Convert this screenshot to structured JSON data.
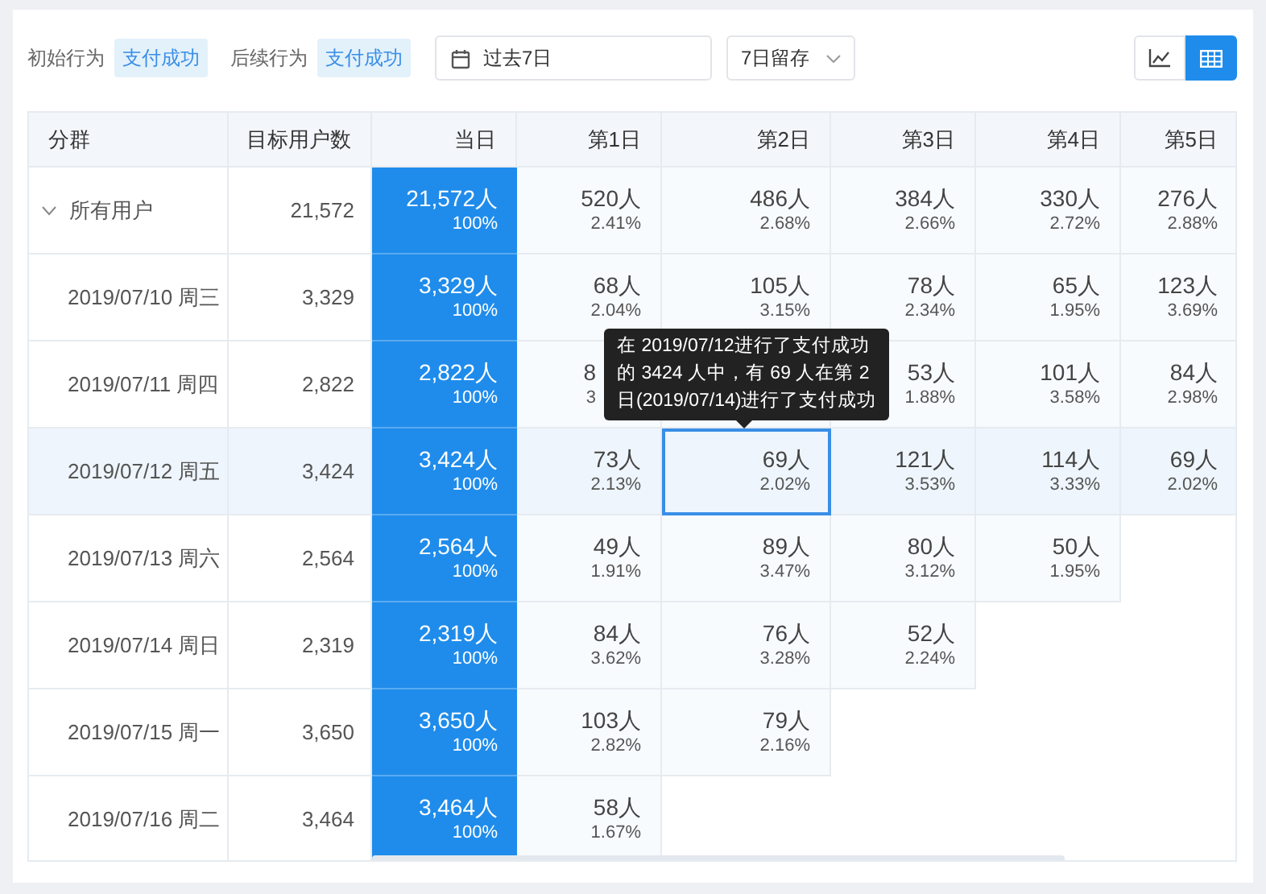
{
  "filters": [
    {
      "label": "初始行为",
      "tag": "支付成功"
    },
    {
      "label": "后续行为",
      "tag": "支付成功"
    }
  ],
  "date_range": {
    "value": "过去7日"
  },
  "retention_select": {
    "value": "7日留存"
  },
  "view_toggle": [
    {
      "kind": "line",
      "selected": false
    },
    {
      "kind": "table",
      "selected": true
    }
  ],
  "table": {
    "columns": [
      "分群",
      "目标用户数",
      "当日",
      "第1日",
      "第2日",
      "第3日",
      "第4日",
      "第5日"
    ],
    "rows": [
      {
        "kind": "group",
        "expanded": true,
        "selected": false,
        "label": "所有用户",
        "target": "21,572",
        "day0": {
          "count": "21,572人",
          "pct": "100%"
        },
        "days": [
          {
            "count": "520人",
            "pct": "2.41%",
            "selected": false
          },
          {
            "count": "486人",
            "pct": "2.68%",
            "selected": false
          },
          {
            "count": "384人",
            "pct": "2.66%",
            "selected": false
          },
          {
            "count": "330人",
            "pct": "2.72%",
            "selected": false
          },
          {
            "count": "276人",
            "pct": "2.88%",
            "selected": false
          }
        ]
      },
      {
        "kind": "date",
        "selected": false,
        "label": "2019/07/10 周三",
        "target": "3,329",
        "day0": {
          "count": "3,329人",
          "pct": "100%"
        },
        "days": [
          {
            "count": "68人",
            "pct": "2.04%",
            "selected": false
          },
          {
            "count": "105人",
            "pct": "3.15%",
            "selected": false
          },
          {
            "count": "78人",
            "pct": "2.34%",
            "selected": false
          },
          {
            "count": "65人",
            "pct": "1.95%",
            "selected": false
          },
          {
            "count": "123人",
            "pct": "3.69%",
            "selected": false
          }
        ]
      },
      {
        "kind": "date",
        "selected": false,
        "label": "2019/07/11 周四",
        "target": "2,822",
        "day0": {
          "count": "2,822人",
          "pct": "100%"
        },
        "days": [
          {
            "count": "8",
            "pct": "3",
            "selected": false,
            "clipped": true
          },
          {
            "hidden": true,
            "selected": false
          },
          {
            "count": "53人",
            "pct": "1.88%",
            "selected": false
          },
          {
            "count": "101人",
            "pct": "3.58%",
            "selected": false
          },
          {
            "count": "84人",
            "pct": "2.98%",
            "selected": false
          }
        ]
      },
      {
        "kind": "date",
        "selected": true,
        "label": "2019/07/12 周五",
        "target": "3,424",
        "day0": {
          "count": "3,424人",
          "pct": "100%"
        },
        "days": [
          {
            "count": "73人",
            "pct": "2.13%",
            "selected": false
          },
          {
            "count": "69人",
            "pct": "2.02%",
            "selected": true
          },
          {
            "count": "121人",
            "pct": "3.53%",
            "selected": false
          },
          {
            "count": "114人",
            "pct": "3.33%",
            "selected": false
          },
          {
            "count": "69人",
            "pct": "2.02%",
            "selected": false
          }
        ]
      },
      {
        "kind": "date",
        "selected": false,
        "label": "2019/07/13 周六",
        "target": "2,564",
        "day0": {
          "count": "2,564人",
          "pct": "100%"
        },
        "days": [
          {
            "count": "49人",
            "pct": "1.91%",
            "selected": false
          },
          {
            "count": "89人",
            "pct": "3.47%",
            "selected": false
          },
          {
            "count": "80人",
            "pct": "3.12%",
            "selected": false
          },
          {
            "count": "50人",
            "pct": "1.95%",
            "selected": false
          }
        ]
      },
      {
        "kind": "date",
        "selected": false,
        "label": "2019/07/14 周日",
        "target": "2,319",
        "day0": {
          "count": "2,319人",
          "pct": "100%"
        },
        "days": [
          {
            "count": "84人",
            "pct": "3.62%",
            "selected": false
          },
          {
            "count": "76人",
            "pct": "3.28%",
            "selected": false
          },
          {
            "count": "52人",
            "pct": "2.24%",
            "selected": false
          }
        ]
      },
      {
        "kind": "date",
        "selected": false,
        "label": "2019/07/15 周一",
        "target": "3,650",
        "day0": {
          "count": "3,650人",
          "pct": "100%"
        },
        "days": [
          {
            "count": "103人",
            "pct": "2.82%",
            "selected": false
          },
          {
            "count": "79人",
            "pct": "2.16%",
            "selected": false
          }
        ]
      },
      {
        "kind": "date",
        "selected": false,
        "label": "2019/07/16 周二",
        "target": "3,464",
        "day0": {
          "count": "3,464人",
          "pct": "100%"
        },
        "days": [
          {
            "count": "58人",
            "pct": "1.67%",
            "selected": false
          }
        ]
      }
    ]
  },
  "tooltip": {
    "lines": [
      "在 2019/07/12进行了支付成功",
      "的 3424 人中，有 69 人在第 2",
      "日(2019/07/14)进行了支付成功"
    ]
  }
}
